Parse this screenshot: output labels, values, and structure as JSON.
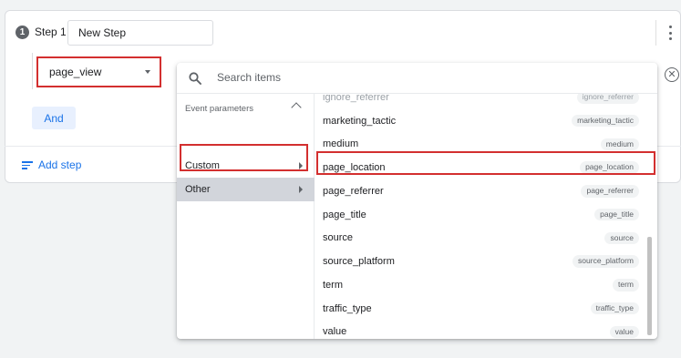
{
  "step": {
    "number": "1",
    "label": "Step 1",
    "name_value": "New Step"
  },
  "event_select": {
    "value": "page_view"
  },
  "and_label": "And",
  "add_step_label": "Add step",
  "dropdown": {
    "search_placeholder": "Search items",
    "categories_header": "Event parameters",
    "categories": [
      {
        "label": "Custom"
      },
      {
        "label": "Other"
      }
    ],
    "items": [
      {
        "name": "ignore_referrer",
        "chip": "ignore_referrer"
      },
      {
        "name": "marketing_tactic",
        "chip": "marketing_tactic"
      },
      {
        "name": "medium",
        "chip": "medium"
      },
      {
        "name": "page_location",
        "chip": "page_location"
      },
      {
        "name": "page_referrer",
        "chip": "page_referrer"
      },
      {
        "name": "page_title",
        "chip": "page_title"
      },
      {
        "name": "source",
        "chip": "source"
      },
      {
        "name": "source_platform",
        "chip": "source_platform"
      },
      {
        "name": "term",
        "chip": "term"
      },
      {
        "name": "traffic_type",
        "chip": "traffic_type"
      },
      {
        "name": "value",
        "chip": "value"
      }
    ]
  },
  "icons": {
    "search": "search-icon",
    "more": "more-vert-icon",
    "clear": "close-circle-icon",
    "add_step": "sort-lines-icon"
  },
  "colors": {
    "accent": "#1a73e8",
    "highlight": "#d32f2f",
    "selected_row": "#d2d5db"
  }
}
